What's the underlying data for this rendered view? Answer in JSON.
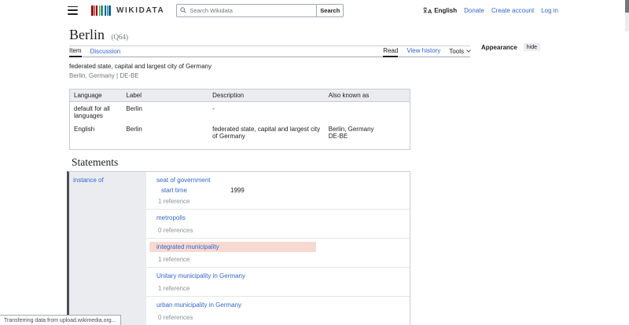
{
  "header": {
    "logo_text": "WIKIDATA",
    "search": {
      "placeholder": "Search Wikidata",
      "button_label": "Search"
    },
    "language_label": "English",
    "links": {
      "donate": "Donate",
      "create_account": "Create account",
      "login": "Log in"
    }
  },
  "page": {
    "title": "Berlin",
    "entity_id": "(Q64)",
    "description": "federated state, capital and largest city of Germany",
    "aliases": "Berlin, Germany | DE-BE"
  },
  "tabs": {
    "item": "Item",
    "discussion": "Discussion",
    "read": "Read",
    "view_history": "View history",
    "tools": "Tools"
  },
  "appearance": {
    "label": "Appearance",
    "hide_label": "hide"
  },
  "term_table": {
    "headers": [
      "Language",
      "Label",
      "Description",
      "Also known as"
    ],
    "rows": [
      {
        "language": "default for all languages",
        "label": "Berlin",
        "description": "-",
        "also_line1": "",
        "also_line2": ""
      },
      {
        "language": "English",
        "label": "Berlin",
        "description": "federated state, capital and largest city of Germany",
        "also_line1": "Berlin, Germany",
        "also_line2": "DE-BE"
      }
    ]
  },
  "statements": {
    "heading": "Statements",
    "property": "instance of",
    "values": [
      {
        "value": "seat of government",
        "qualifier_property": "start time",
        "qualifier_value": "1999",
        "references": "1 reference"
      },
      {
        "value": "metropolis",
        "references": "0 references"
      },
      {
        "value": "integrated municipality",
        "references": "1 reference"
      },
      {
        "value": "Unitary municipality in Germany",
        "references": "1 reference"
      },
      {
        "value": "urban municipality in Germany",
        "references": "0 references"
      }
    ]
  },
  "status_bar": {
    "text": "Transferring data from upload.wikimedia.org..."
  },
  "colors": {
    "link": "#3366cc",
    "highlight": "#f8d9d2",
    "cell_bg": "#eaecf0",
    "logo_red": "#990000",
    "logo_green": "#339966",
    "logo_blue": "#006699"
  }
}
